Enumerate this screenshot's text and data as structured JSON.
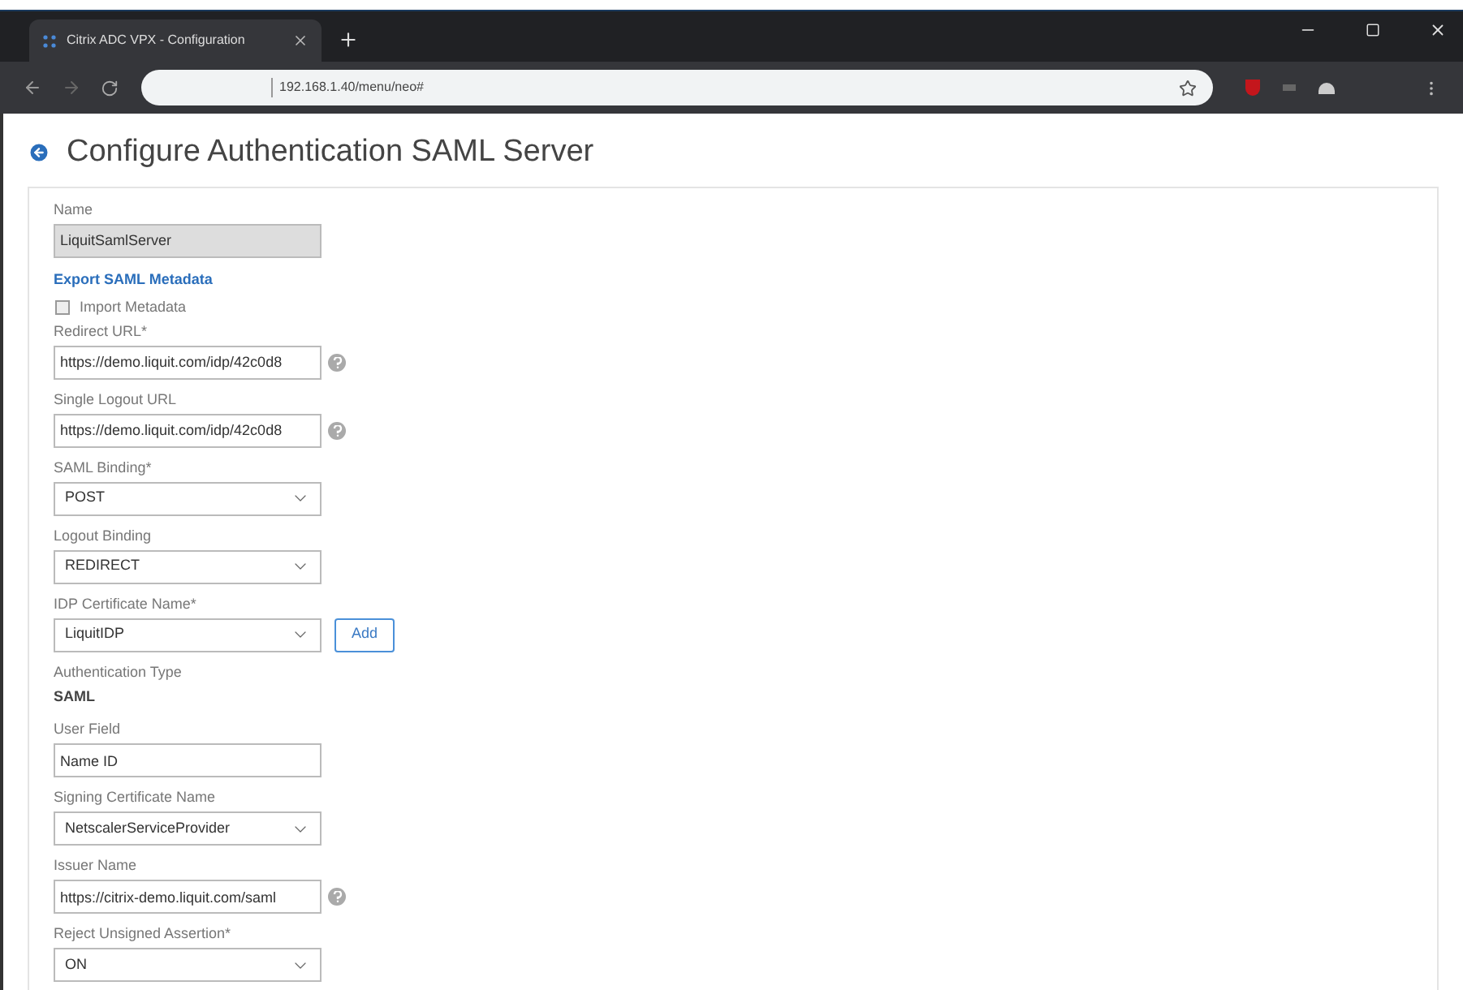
{
  "browser": {
    "tab": {
      "title": "Citrix ADC VPX - Configuration",
      "selected": true
    },
    "address": "192.168.1.40/menu/neo#"
  },
  "page": {
    "title": "Configure Authentication SAML Server"
  },
  "form": [
    {
      "kind": "text",
      "label": "Name",
      "value": "LiquitSamlServer",
      "disabled": true
    },
    {
      "kind": "link",
      "label": "Export SAML Metadata"
    },
    {
      "kind": "checkbox",
      "label": "Import Metadata",
      "checked": false
    },
    {
      "kind": "text",
      "label": "Redirect URL*",
      "value": "https://demo.liquit.com/idp/42c0d8",
      "help": true,
      "disabled": false
    },
    {
      "kind": "text",
      "label": "Single Logout URL",
      "value": "https://demo.liquit.com/idp/42c0d8",
      "help": true,
      "disabled": false
    },
    {
      "kind": "select",
      "label": "SAML Binding*",
      "value": "POST"
    },
    {
      "kind": "select",
      "label": "Logout Binding",
      "value": "REDIRECT"
    },
    {
      "kind": "select",
      "label": "IDP Certificate Name*",
      "value": "LiquitIDP",
      "button": "Add"
    },
    {
      "kind": "static",
      "label": "Authentication Type",
      "value": "SAML"
    },
    {
      "kind": "text",
      "label": "User Field",
      "value": "Name ID",
      "disabled": false
    },
    {
      "kind": "select",
      "label": "Signing Certificate Name",
      "value": "NetscalerServiceProvider"
    },
    {
      "kind": "text",
      "label": "Issuer Name",
      "value": "https://citrix-demo.liquit.com/saml",
      "help": true,
      "disabled": false
    },
    {
      "kind": "select",
      "label": "Reject Unsigned Assertion*",
      "value": "ON"
    }
  ]
}
